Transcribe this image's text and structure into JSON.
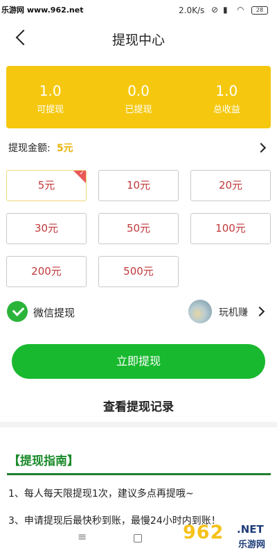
{
  "status_bar": {
    "watermark": "乐游网 www.962.net",
    "time": "",
    "speed": "2.0K/s",
    "battery": "28"
  },
  "header": {
    "title": "提现中心"
  },
  "stats": [
    {
      "value": "1.0",
      "label": "可提现"
    },
    {
      "value": "0.0",
      "label": "已提现"
    },
    {
      "value": "1.0",
      "label": "总收益"
    }
  ],
  "amount": {
    "label": "提现金额:",
    "value": "5元"
  },
  "options": [
    {
      "label": "5元",
      "selected": true
    },
    {
      "label": "10元",
      "selected": false
    },
    {
      "label": "20元",
      "selected": false
    },
    {
      "label": "30元",
      "selected": false
    },
    {
      "label": "50元",
      "selected": false
    },
    {
      "label": "100元",
      "selected": false
    },
    {
      "label": "200元",
      "selected": false
    },
    {
      "label": "500元",
      "selected": false
    }
  ],
  "payment": {
    "method": "微信提现",
    "username": "玩机赚"
  },
  "actions": {
    "withdraw_button": "立即提现",
    "records_link": "查看提现记录"
  },
  "guide": {
    "title": "【提现指南】",
    "lines": [
      "1、每人每天限提现1次，建议多点再提哦~",
      "3、申请提现后最快秒到账，最慢24小时内到账！"
    ]
  },
  "nav_bar": {
    "menu_icon": "≡",
    "watermark_logo": "962",
    "watermark_net": ".NET",
    "watermark_site": "乐游网"
  },
  "colors": {
    "accent_yellow": "#f5c80f",
    "cta_green": "#19b92f",
    "option_red": "#c0393b",
    "guide_green": "#1a8a2a"
  }
}
